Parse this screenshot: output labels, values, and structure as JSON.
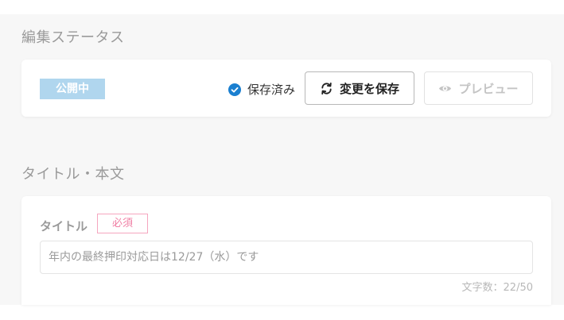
{
  "status_section": {
    "title": "編集ステータス",
    "status_badge": "公開中",
    "saved_text": "保存済み",
    "save_button": "変更を保存",
    "preview_button": "プレビュー"
  },
  "content_section": {
    "title": "タイトル・本文",
    "title_field": {
      "label": "タイトル",
      "required_badge": "必須",
      "value": "年内の最終押印対応日は12/27（水）です",
      "char_count": "文字数：22/50"
    }
  },
  "icons": {
    "saved": "check-circle-icon",
    "save": "refresh-icon",
    "preview": "eye-icon"
  },
  "colors": {
    "status_badge_bg": "#b0d6ee",
    "check_blue": "#1a7fd0",
    "required_pink": "#f07fa4",
    "disabled_gray": "#c4c4c4"
  }
}
